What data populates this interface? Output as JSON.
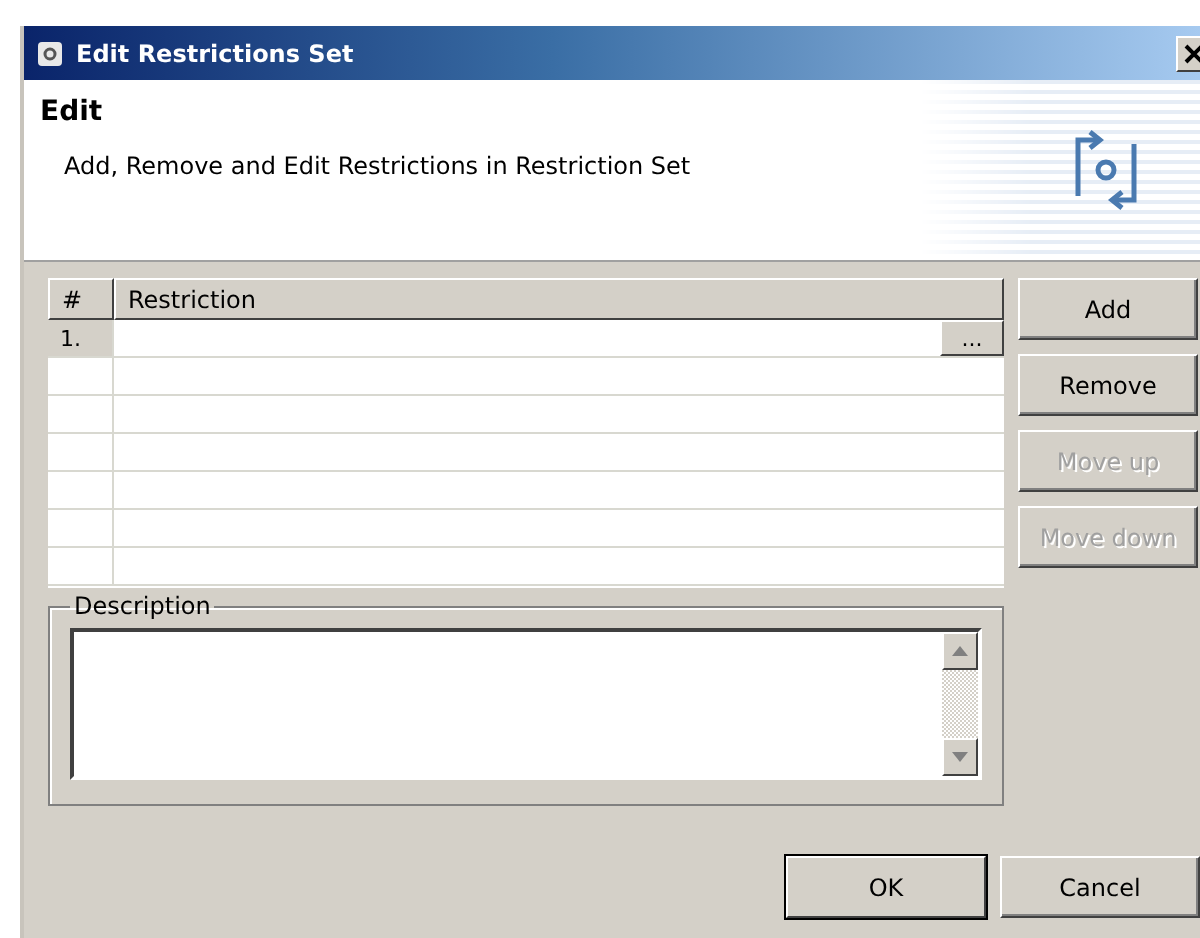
{
  "window": {
    "title": "Edit Restrictions Set"
  },
  "header": {
    "title": "Edit",
    "subtitle": "Add, Remove and Edit Restrictions in Restriction Set"
  },
  "table": {
    "columns": [
      "#",
      "Restriction"
    ],
    "rows": [
      {
        "number": "1.",
        "selected": true,
        "edit_button": "..."
      }
    ]
  },
  "side_buttons": [
    {
      "label": "Add",
      "disabled": false
    },
    {
      "label": "Remove",
      "disabled": false
    },
    {
      "label": "Move up",
      "disabled": true
    },
    {
      "label": "Move down",
      "disabled": true
    }
  ],
  "description": {
    "label": "Description"
  },
  "buttons": [
    {
      "label": "OK",
      "default": true
    },
    {
      "label": "Cancel",
      "default": false
    }
  ]
}
